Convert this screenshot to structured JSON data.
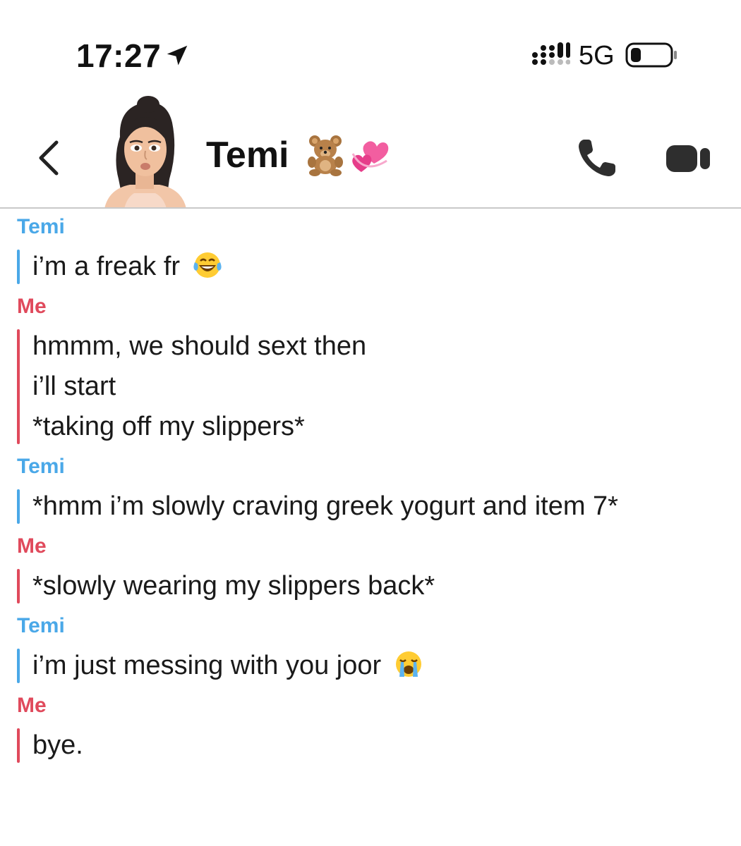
{
  "status_bar": {
    "time": "17:27",
    "network": "5G",
    "icons": [
      "location-arrow-icon",
      "signal-bars-icon",
      "battery-icon"
    ]
  },
  "header": {
    "back_icon": "chevron-left-icon",
    "contact_name": "Temi",
    "name_emojis": [
      "teddy-bear-emoji",
      "revolving-hearts-emoji"
    ],
    "call_icon": "phone-icon",
    "video_icon": "video-camera-icon"
  },
  "colors": {
    "temi": "#4aa8e8",
    "me": "#e04a5c",
    "text": "#1a1a1a",
    "divider": "#c9c9c9"
  },
  "messages": [
    {
      "sender": "Temi",
      "lines": [
        "i’m a freak fr"
      ],
      "emoji": "tears-of-joy-emoji"
    },
    {
      "sender": "Me",
      "lines": [
        "hmmm, we should sext then",
        "i’ll start",
        "*taking off my slippers*"
      ]
    },
    {
      "sender": "Temi",
      "lines": [
        "*hmm i’m slowly craving greek yogurt and item 7*"
      ]
    },
    {
      "sender": "Me",
      "lines": [
        "*slowly wearing my slippers back*"
      ]
    },
    {
      "sender": "Temi",
      "lines": [
        "i’m just messing with you joor"
      ],
      "emoji": "loudly-crying-emoji"
    },
    {
      "sender": "Me",
      "lines": [
        "bye."
      ]
    }
  ]
}
